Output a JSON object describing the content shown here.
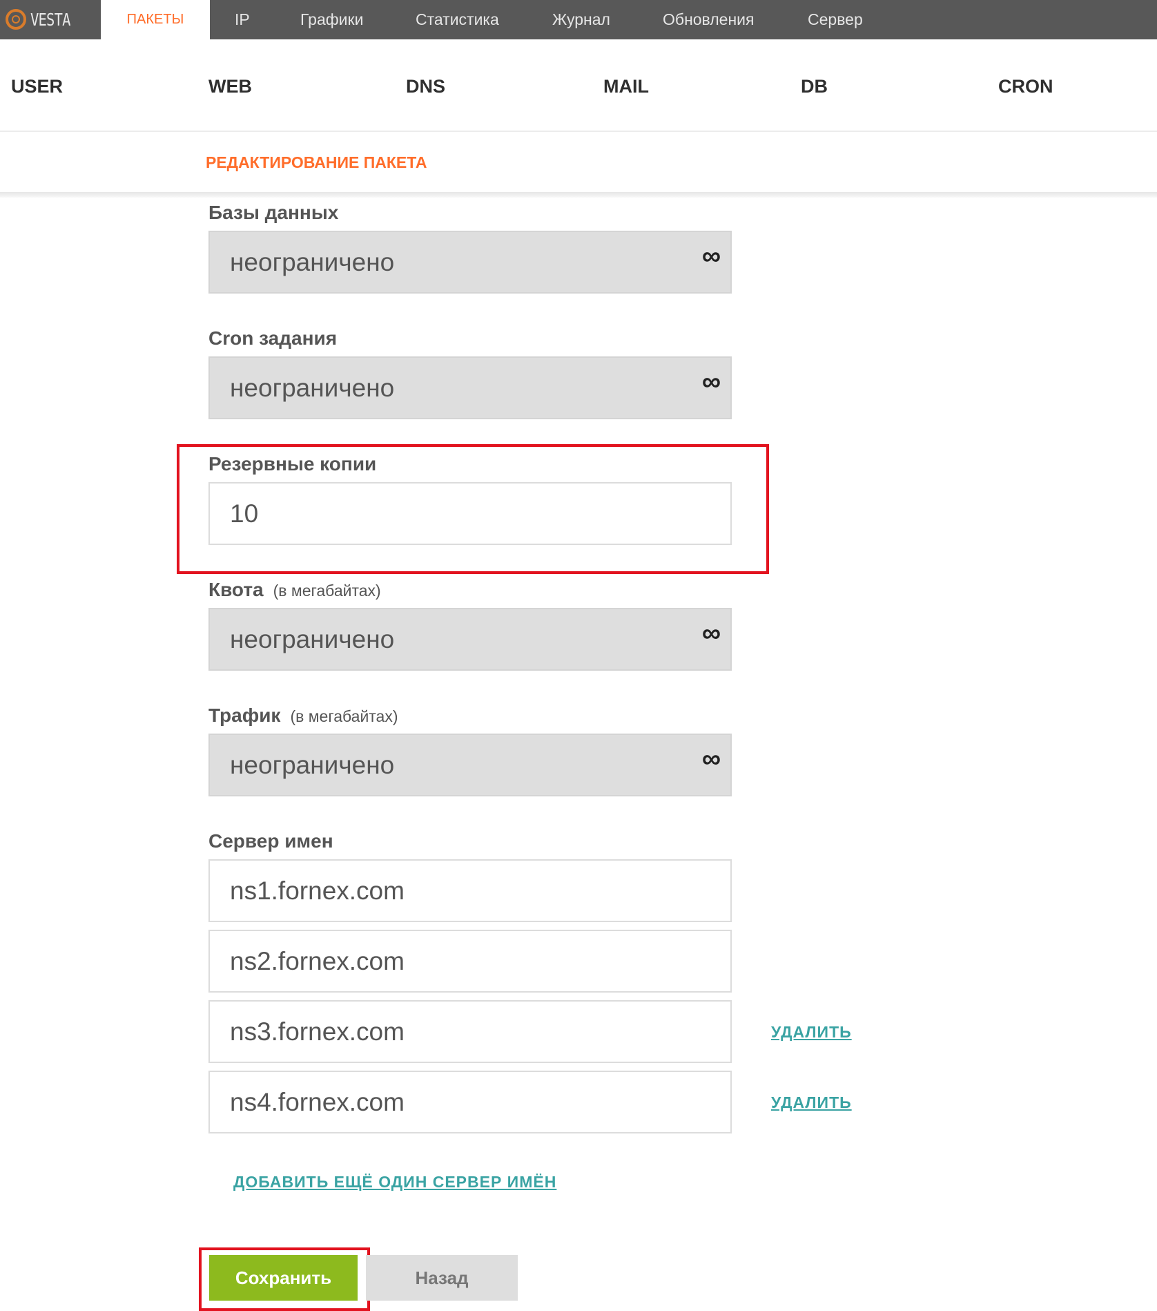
{
  "app": {
    "logo_text": "VESTA"
  },
  "top_nav": {
    "active": "ПАКЕТЫ",
    "items": [
      "IP",
      "Графики",
      "Статистика",
      "Журнал",
      "Обновления",
      "Сервер"
    ]
  },
  "sub_nav": [
    "USER",
    "WEB",
    "DNS",
    "MAIL",
    "DB",
    "CRON"
  ],
  "section_title": "РЕДАКТИРОВАНИЕ ПАКЕТА",
  "form": {
    "databases": {
      "label": "Базы данных",
      "value": "неограничено",
      "unlimited_symbol": "∞"
    },
    "cron": {
      "label": "Cron задания",
      "value": "неограничено",
      "unlimited_symbol": "∞"
    },
    "backups": {
      "label": "Резервные копии",
      "value": "10"
    },
    "quota": {
      "label": "Квота",
      "hint": "(в мегабайтах)",
      "value": "неограничено",
      "unlimited_symbol": "∞"
    },
    "traffic": {
      "label": "Трафик",
      "hint": "(в мегабайтах)",
      "value": "неограничено",
      "unlimited_symbol": "∞"
    },
    "nameservers": {
      "label": "Сервер имен",
      "values": [
        "ns1.fornex.com",
        "ns2.fornex.com",
        "ns3.fornex.com",
        "ns4.fornex.com"
      ],
      "remove_label": "УДАЛИТЬ",
      "add_label": "ДОБАВИТЬ ЕЩЁ ОДИН СЕРВЕР ИМЁН"
    }
  },
  "buttons": {
    "save": "Сохранить",
    "back": "Назад"
  },
  "colors": {
    "accent": "#ff6d2a",
    "save_button": "#8dba1e",
    "link": "#3aa3a3",
    "highlight": "#e2131f"
  }
}
